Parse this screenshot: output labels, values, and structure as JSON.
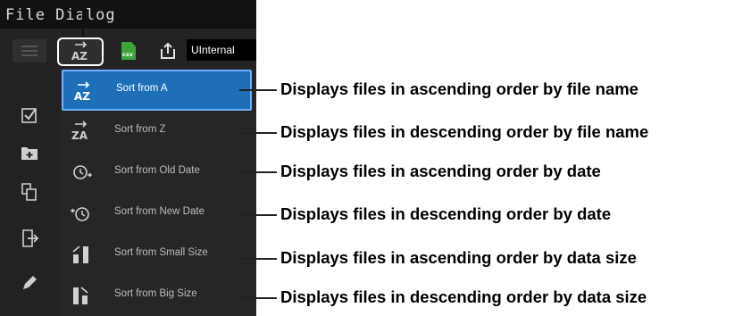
{
  "dialog": {
    "title": "File Dialog",
    "toolbar": {
      "csv_label": "csv",
      "drive": "UInternal"
    },
    "sidebar": {
      "icons": [
        "check-list-icon",
        "new-folder-icon",
        "copy-icon",
        "move-icon",
        "rename-pencil-icon"
      ]
    },
    "sort_menu": {
      "items": [
        {
          "icon_text": "AZ",
          "label": "Sort from A",
          "selected": true
        },
        {
          "icon_text": "ZA",
          "label": "Sort from Z",
          "selected": false
        },
        {
          "icon_text": "",
          "label": "Sort from Old Date",
          "selected": false
        },
        {
          "icon_text": "",
          "label": "Sort from New Date",
          "selected": false
        },
        {
          "icon_text": "",
          "label": "Sort from Small Size",
          "selected": false
        },
        {
          "icon_text": "",
          "label": "Sort from Big Size",
          "selected": false
        }
      ]
    }
  },
  "callouts": [
    "Displays files in ascending order by file name",
    "Displays files in descending order by file name",
    "Displays files in ascending order by date",
    "Displays files in descending order by date",
    "Displays files in ascending order by data size",
    "Displays files in descending order by data size"
  ],
  "colors": {
    "selected_bg": "#1e6fb8",
    "csv_icon": "#3aa63a"
  }
}
